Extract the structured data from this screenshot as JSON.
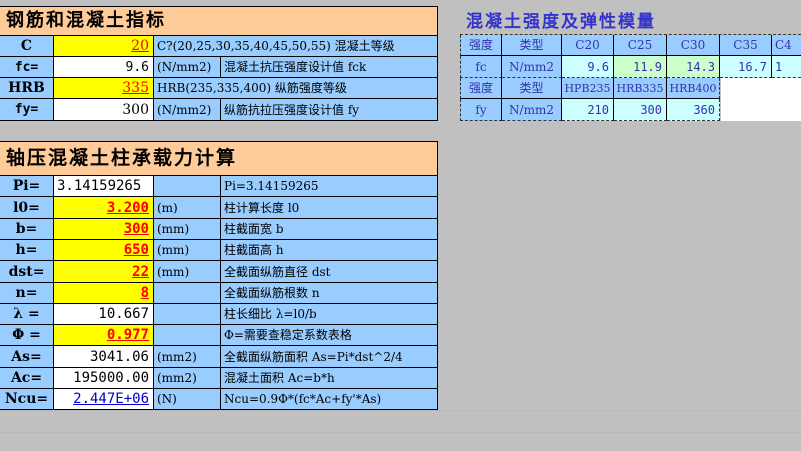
{
  "sheet_top": {
    "title": "钢筋和混凝土指标",
    "rows": [
      {
        "label": "C",
        "value": "20",
        "unit": "C?(20,25,30,35,40,45,50,55) 混凝土等级",
        "desc": ""
      },
      {
        "label": "fc=",
        "value": "9.6",
        "unit": "(N/mm2)",
        "desc": "混凝土抗压强度设计值 fck"
      },
      {
        "label": "HRB",
        "value": "335",
        "unit": "HRB(235,335,400) 纵筋强度等级",
        "desc": ""
      },
      {
        "label": "fy=",
        "value": "300",
        "unit": "(N/mm2)",
        "desc": "纵筋抗拉压强度设计值 fy"
      }
    ]
  },
  "strength_table": {
    "title": "混凝土强度及弹性模量",
    "row1": {
      "cells": [
        "强度",
        "类型",
        "C20",
        "C25",
        "C30",
        "C35",
        "C4"
      ]
    },
    "row2": {
      "cells": [
        "fc",
        "N/mm2",
        "9.6",
        "11.9",
        "14.3",
        "16.7",
        "1"
      ]
    },
    "row3": {
      "cells": [
        "强度",
        "类型",
        "HPB235",
        "HRB335",
        "HRB400"
      ]
    },
    "row4": {
      "cells": [
        "fy",
        "N/mm2",
        "210",
        "300",
        "360"
      ]
    }
  },
  "sheet_calc": {
    "title": "轴压混凝土柱承载力计算",
    "rows": [
      {
        "label": "Pi=",
        "value": "3.14159265",
        "unit": "",
        "desc": "Pi=3.14159265"
      },
      {
        "label": "l0=",
        "value": "3.200",
        "unit": "(m)",
        "desc": "柱计算长度 l0"
      },
      {
        "label": "b=",
        "value": "300",
        "unit": "(mm)",
        "desc": "柱截面宽 b"
      },
      {
        "label": "h=",
        "value": "650",
        "unit": "(mm)",
        "desc": "柱截面高 h"
      },
      {
        "label": "dst=",
        "value": "22",
        "unit": "(mm)",
        "desc": "全截面纵筋直径 dst"
      },
      {
        "label": "n=",
        "value": "8",
        "unit": "",
        "desc": "全截面纵筋根数 n"
      },
      {
        "label": "λ =",
        "value": "10.667",
        "unit": "",
        "desc": "柱长细比 λ=l0/b"
      },
      {
        "label": "Φ =",
        "value": "0.977",
        "unit": "",
        "desc": "Φ=需要查稳定系数表格"
      },
      {
        "label": "As=",
        "value": "3041.06",
        "unit": "(mm2)",
        "desc": "全截面纵筋面积 As=Pi*dst^2/4"
      },
      {
        "label": "Ac=",
        "value": "195000.00",
        "unit": "(mm2)",
        "desc": "混凝土面积 Ac=b*h"
      },
      {
        "label": "Ncu=",
        "value": "2.447E+06",
        "unit": "(N)",
        "desc": "Ncu=0.9Φ*(fc*Ac+fy'*As)"
      }
    ]
  },
  "colors": {
    "blue": "#99ccff",
    "yellow": "#ffff00",
    "peach": "#ffcc99",
    "light_cyan": "#ccffff",
    "light_green": "#ccffcc",
    "red": "#ff0000",
    "navy": "#0000cc"
  }
}
